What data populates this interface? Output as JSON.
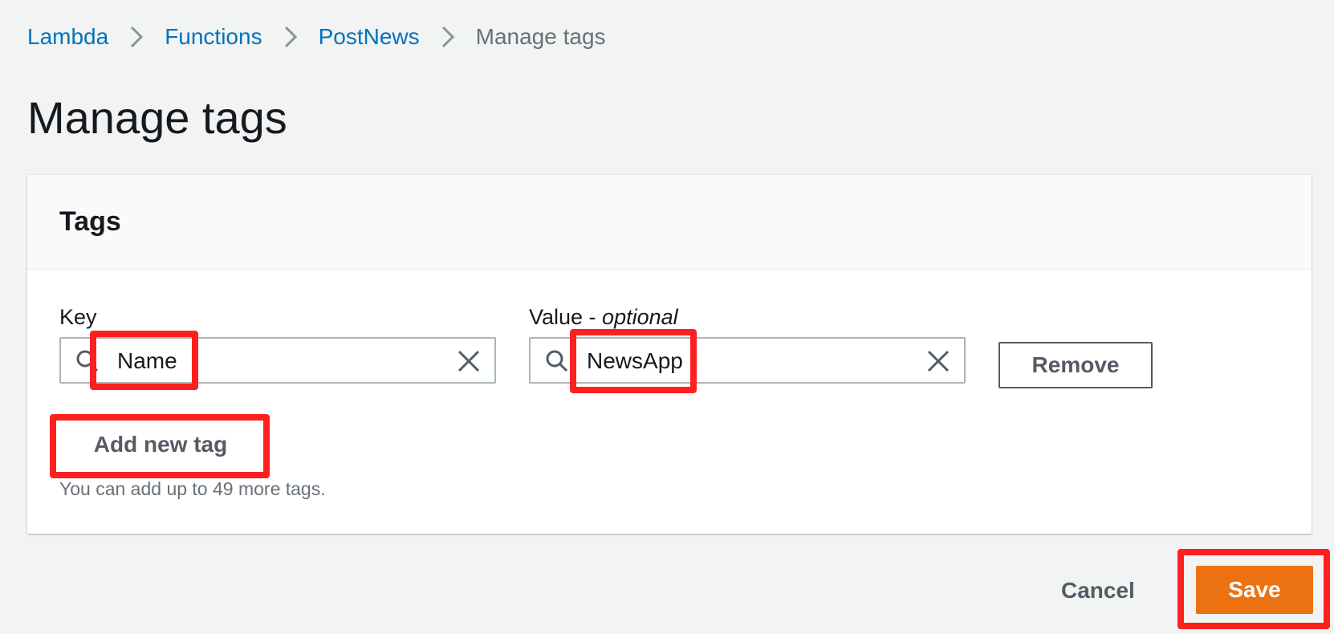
{
  "breadcrumb": {
    "items": [
      "Lambda",
      "Functions",
      "PostNews"
    ],
    "current": "Manage tags"
  },
  "page": {
    "title": "Manage tags"
  },
  "tags_panel": {
    "title": "Tags",
    "key_label": "Key",
    "value_label": "Value - ",
    "value_label_optional": "optional",
    "rows": [
      {
        "key": "Name",
        "value": "NewsApp"
      }
    ],
    "remove_label": "Remove",
    "add_label": "Add new tag",
    "hint": "You can add up to 49 more tags."
  },
  "footer": {
    "cancel_label": "Cancel",
    "save_label": "Save"
  },
  "icons": {
    "search": "search-icon",
    "clear": "close-icon",
    "separator": "chevron-right-icon"
  },
  "colors": {
    "link": "#0073bb",
    "primary_button": "#ec7211",
    "highlight": "#ff1f1f",
    "background": "#f2f3f3"
  }
}
